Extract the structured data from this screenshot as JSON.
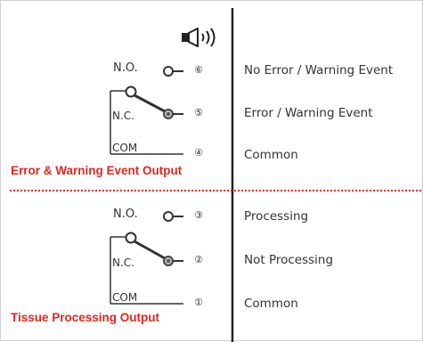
{
  "colors": {
    "line": "#333333",
    "accent": "#e8231c",
    "text": "#333333"
  },
  "icons": {
    "buzzer": "speaker-icon"
  },
  "error_section": {
    "title": "Error & Warning Event Output",
    "no_label": "N.O.",
    "nc_label": "N.C.",
    "com_label": "COM",
    "pins": [
      "⑥",
      "⑤",
      "④"
    ],
    "descriptions": [
      "No Error / Warning Event",
      "Error / Warning Event",
      "Common"
    ]
  },
  "processing_section": {
    "title": "Tissue Processing Output",
    "no_label": "N.O.",
    "nc_label": "N.C.",
    "com_label": "COM",
    "pins": [
      "③",
      "②",
      "①"
    ],
    "descriptions": [
      "Processing",
      "Not Processing",
      "Common"
    ]
  }
}
